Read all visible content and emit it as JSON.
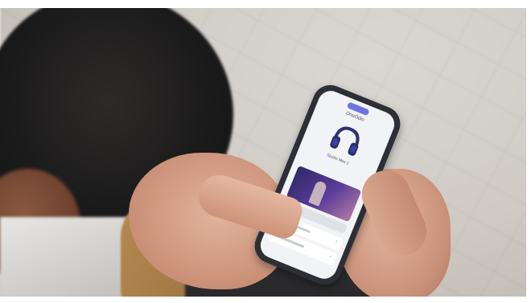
{
  "scene": {
    "subject": "person holding smartphone showing headphone app"
  },
  "phone_screen": {
    "app_title": "OneOdio",
    "device_name": "Studio Max 2",
    "device_status": "",
    "section_label": "",
    "icons": [
      "headphones-icon",
      "chevron-right-icon"
    ]
  }
}
